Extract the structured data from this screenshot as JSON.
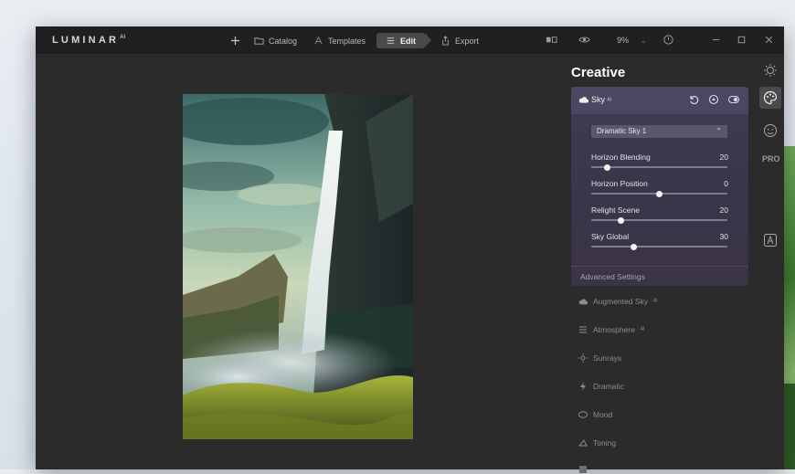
{
  "app": {
    "logo": "LUMINAR",
    "logo_sup": "AI"
  },
  "topbar": {
    "catalog": "Catalog",
    "templates": "Templates",
    "edit": "Edit",
    "export": "Export",
    "zoom": "9%",
    "zoom_caret": "⌄"
  },
  "panel": {
    "title": "Creative",
    "sky": {
      "name": "Sky",
      "badge": "ᴬᴵ",
      "preset": "Dramatic Sky 1",
      "sliders": [
        {
          "label": "Horizon Blending",
          "value": "20",
          "fraction": 0.12
        },
        {
          "label": "Horizon Position",
          "value": "0",
          "fraction": 0.5
        },
        {
          "label": "Relight Scene",
          "value": "20",
          "fraction": 0.22
        },
        {
          "label": "Sky Global",
          "value": "30",
          "fraction": 0.31
        }
      ],
      "advanced": "Advanced Settings"
    },
    "tools": [
      {
        "label": "Augmented Sky",
        "badge": "ᴬᴵ",
        "icon": "cloud-icon"
      },
      {
        "label": "Atmosphere",
        "badge": "ᴬᴵ",
        "icon": "lines-icon"
      },
      {
        "label": "Sunrays",
        "icon": "sun-icon"
      },
      {
        "label": "Dramatic",
        "icon": "bolt-icon"
      },
      {
        "label": "Mood",
        "icon": "mask-icon"
      },
      {
        "label": "Toning",
        "icon": "toning-icon"
      }
    ]
  },
  "rail": {
    "pro": "PRO"
  }
}
